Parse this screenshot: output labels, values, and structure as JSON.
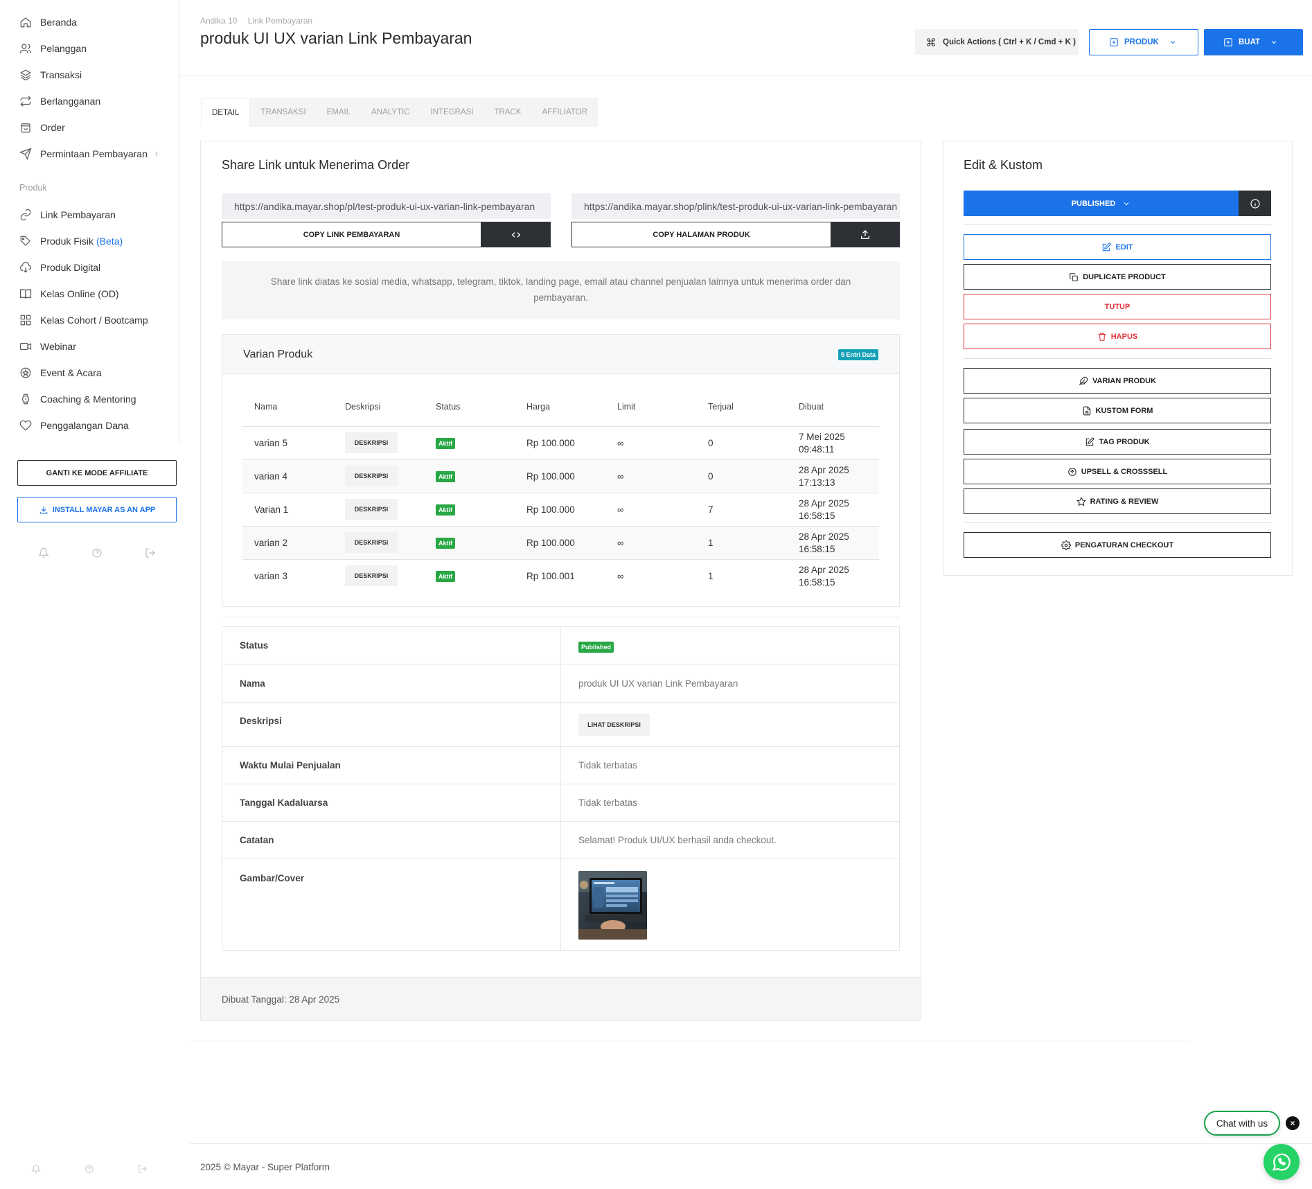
{
  "sidebar": {
    "items": [
      {
        "label": "Beranda",
        "icon": "home-icon"
      },
      {
        "label": "Pelanggan",
        "icon": "users-icon"
      },
      {
        "label": "Transaksi",
        "icon": "layers-icon"
      },
      {
        "label": "Berlangganan",
        "icon": "repeat-icon"
      },
      {
        "label": "Order",
        "icon": "bag-icon"
      },
      {
        "label": "Permintaan Pembayaran",
        "icon": "send-icon"
      }
    ],
    "section_label": "Produk",
    "produk_items": [
      {
        "label": "Link Pembayaran",
        "icon": "link-icon"
      },
      {
        "label": "Produk Fisik",
        "beta": "(Beta)",
        "icon": "tag-icon"
      },
      {
        "label": "Produk Digital",
        "icon": "cloud-download-icon"
      },
      {
        "label": "Kelas Online (OD)",
        "icon": "book-icon"
      },
      {
        "label": "Kelas Cohort / Bootcamp",
        "icon": "grid-icon"
      },
      {
        "label": "Webinar",
        "icon": "video-icon"
      },
      {
        "label": "Event & Acara",
        "icon": "event-icon"
      },
      {
        "label": "Coaching & Mentoring",
        "icon": "watch-icon"
      },
      {
        "label": "Penggalangan Dana",
        "icon": "heart-icon"
      }
    ],
    "affiliate_button": "GANTI KE MODE AFFILIATE",
    "install_button": "INSTALL MAYAR AS AN APP"
  },
  "header": {
    "breadcrumb": [
      "Andika 10",
      "Link Pembayaran"
    ],
    "title": "produk UI UX varian Link Pembayaran",
    "quick_actions": "Quick Actions ( Ctrl + K / Cmd + K )",
    "produk_button": "PRODUK",
    "buat_button": "BUAT"
  },
  "tabs": [
    "DETAIL",
    "TRANSAKSI",
    "EMAIL",
    "ANALYTIC",
    "INTEGRASI",
    "TRACK",
    "AFFILIATOR"
  ],
  "share": {
    "title": "Share Link untuk Menerima Order",
    "link1": "https://andika.mayar.shop/pl/test-produk-ui-ux-varian-link-pembayaran",
    "link2": "https://andika.mayar.shop/plink/test-produk-ui-ux-varian-link-pembayaran",
    "copy1": "COPY LINK PEMBAYARAN",
    "copy2": "COPY HALAMAN PRODUK",
    "info": "Share link diatas ke sosial media, whatsapp, telegram, tiktok, landing page, email atau channel penjualan lainnya untuk menerima order dan pembayaran."
  },
  "varian": {
    "title": "Varian Produk",
    "badge": "5 Entri Data",
    "columns": [
      "Nama",
      "Deskripsi",
      "Status",
      "Harga",
      "Limit",
      "Terjual",
      "Dibuat"
    ],
    "desc_button": "DESKRIPSI",
    "status_label": "Aktif",
    "limit": "∞",
    "rows": [
      {
        "nama": "varian 5",
        "harga": "Rp 100.000",
        "terjual": "0",
        "date": "7 Mei 2025",
        "time": "09:48:11"
      },
      {
        "nama": "varian 4",
        "harga": "Rp 100.000",
        "terjual": "0",
        "date": "28 Apr 2025",
        "time": "17:13:13"
      },
      {
        "nama": "Varian 1",
        "harga": "Rp 100.000",
        "terjual": "7",
        "date": "28 Apr 2025",
        "time": "16:58:15"
      },
      {
        "nama": "varian 2",
        "harga": "Rp 100.000",
        "terjual": "1",
        "date": "28 Apr 2025",
        "time": "16:58:15"
      },
      {
        "nama": "varian 3",
        "harga": "Rp 100.001",
        "terjual": "1",
        "date": "28 Apr 2025",
        "time": "16:58:15"
      }
    ]
  },
  "details": {
    "status_label": "Status",
    "status_value": "Published",
    "nama_label": "Nama",
    "nama_value": "produk UI UX varian Link Pembayaran",
    "deskripsi_label": "Deskripsi",
    "deskripsi_button": "LIHAT DESKRIPSI",
    "waktu_label": "Waktu Mulai Penjualan",
    "waktu_value": "Tidak terbatas",
    "kadaluarsa_label": "Tanggal Kadaluarsa",
    "kadaluarsa_value": "Tidak terbatas",
    "catatan_label": "Catatan",
    "catatan_value": "Selamat! Produk UI/UX berhasil anda checkout.",
    "cover_label": "Gambar/Cover"
  },
  "created": "Dibuat Tanggal: 28 Apr 2025",
  "edit": {
    "title": "Edit & Kustom",
    "published": "PUBLISHED",
    "buttons": {
      "edit": "EDIT",
      "duplicate": "DUPLICATE PRODUCT",
      "tutup": "TUTUP",
      "hapus": "HAPUS",
      "varian": "VARIAN PRODUK",
      "kustom": "KUSTOM FORM",
      "tag": "TAG PRODUK",
      "upsell": "UPSELL & CROSSSELL",
      "rating": "RATING & REVIEW",
      "checkout": "PENGATURAN CHECKOUT"
    }
  },
  "footer": "2025 © Mayar - Super Platform",
  "chat": "Chat with us",
  "colors": {
    "primary": "#1a73e8",
    "success": "#28a745",
    "danger": "#e0323c",
    "info": "#17a2b8",
    "dark": "#2d3035",
    "whatsapp": "#25d366"
  }
}
